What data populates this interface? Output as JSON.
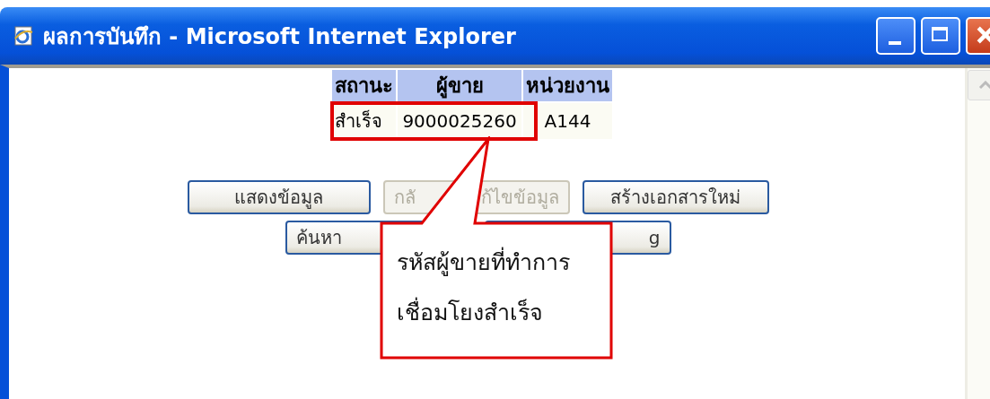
{
  "window": {
    "title": "ผลการบันทึก - Microsoft Internet Explorer"
  },
  "table": {
    "columns": [
      "สถานะ",
      "ผู้ขาย",
      "หน่วยงาน"
    ],
    "rows": [
      {
        "cells": [
          "สำเร็จ",
          "9000025260",
          "A144"
        ],
        "highlighted": true
      }
    ]
  },
  "button_rows": [
    [
      {
        "label": "แสดงข้อมูล",
        "disabled": false
      },
      {
        "label_start": "กลั",
        "label_end": "ก้ไขข้อมูล",
        "disabled": true
      },
      {
        "label": "สร้างเอกสารใหม่",
        "disabled": false
      }
    ],
    [
      {
        "label_start": "ค้นหา",
        "disabled": false
      },
      {
        "label_end": "g",
        "disabled": false
      }
    ]
  ],
  "callout": {
    "lines": [
      "รหัสผู้ขายที่ทำการ",
      "เชื่อมโยงสำเร็จ"
    ]
  }
}
